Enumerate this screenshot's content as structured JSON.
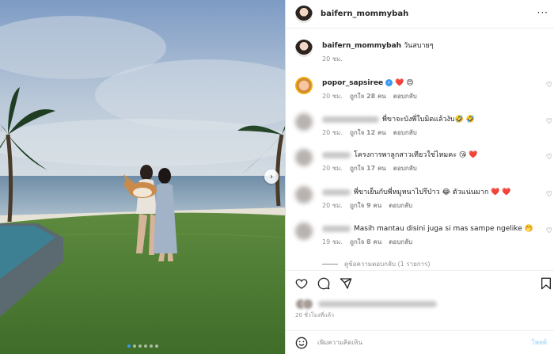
{
  "post": {
    "username": "baifern_mommybah",
    "caption": {
      "username": "baifern_mommybah",
      "text": "วันสบายๆ",
      "time": "20 ชม."
    },
    "comments": [
      {
        "username": "popor_sapsiree",
        "verified": true,
        "text": "❤️ 😍",
        "time": "20 ชม.",
        "likes": "ถูกใจ 28 คน",
        "reply": "ตอบกลับ"
      },
      {
        "username": "",
        "text": "พี่ขาจะบังพี่ใบมิดแล้วงับ🤣 🤣",
        "time": "20 ชม.",
        "likes": "ถูกใจ 12 คน",
        "reply": "ตอบกลับ"
      },
      {
        "username": "",
        "text": "โครงการพาลูกสาวเทียวใช่ไหมคะ 😘 ❤️",
        "time": "20 ชม.",
        "likes": "ถูกใจ 17 คน",
        "reply": "ตอบกลับ"
      },
      {
        "username": "",
        "text": "พี่ขาเย็นกับพี่หมูหนาไปรึป่าว 😂 ตัวแน่นมาก ❤️ ❤️",
        "time": "20 ชม.",
        "likes": "ถูกใจ 9 คน",
        "reply": "ตอบกลับ"
      },
      {
        "username": "",
        "text": "Masih mantau disini juga si mas sampe ngelike 🤭",
        "time": "19 ชม.",
        "likes": "ถูกใจ 8 คน",
        "reply": "ตอบกลับ"
      }
    ],
    "view_replies": "ดูข้อความตอบกลับ (1 รายการ)",
    "time_ago": "20 ชั่วโมงที่แล้ว",
    "comment_placeholder": "เพิ่มความคิดเห็น",
    "post_button": "โพสต์",
    "carousel": {
      "count": 6,
      "active_index": 0
    },
    "icons": {
      "heart": "heart-icon",
      "comment": "comment-icon",
      "share": "share-icon",
      "save": "bookmark-icon",
      "emoji": "emoji-icon",
      "more": "more-icon",
      "next": "chevron-right-icon"
    },
    "colors": {
      "accent": "#3897f0",
      "verified": "#3897f0",
      "like_heart": "#ed4956"
    }
  }
}
